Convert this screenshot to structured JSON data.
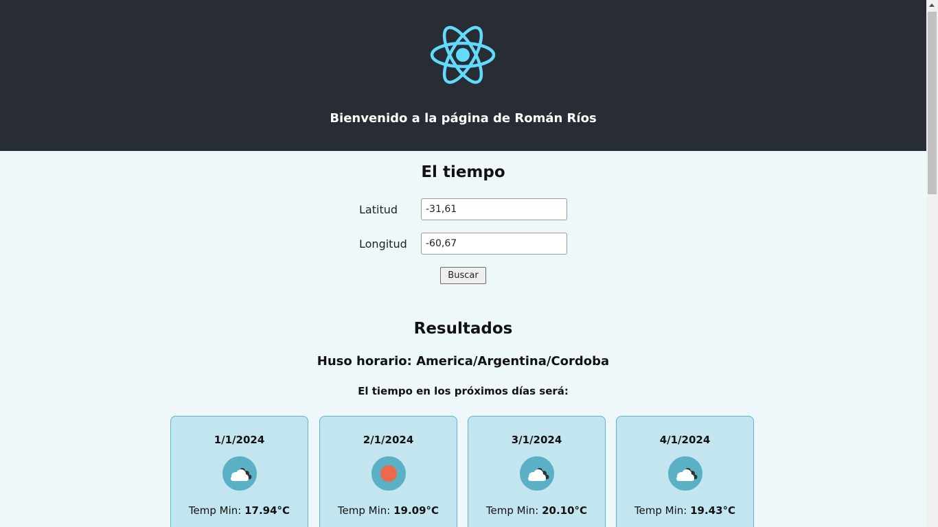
{
  "header": {
    "logo_icon": "react-atom-logo-icon",
    "title": "Bienvenido a la página de Román Ríos"
  },
  "weather": {
    "title": "El tiempo",
    "latitude_label": "Latitud",
    "latitude_value": "-31,61",
    "longitude_label": "Longitud",
    "longitude_value": "-60,67",
    "search_label": "Buscar"
  },
  "results": {
    "title": "Resultados",
    "timezone": "Huso horario: America/Argentina/Cordoba",
    "subtitle": "El tiempo en los próximos días será:",
    "temp_min_label": "Temp Min:",
    "days": [
      {
        "date": "1/1/2024",
        "icon": "cloudy-icon",
        "temp_min": "17.94°C"
      },
      {
        "date": "2/1/2024",
        "icon": "sun-icon",
        "temp_min": "19.09°C"
      },
      {
        "date": "3/1/2024",
        "icon": "cloudy-icon",
        "temp_min": "20.10°C"
      },
      {
        "date": "4/1/2024",
        "icon": "cloudy-icon",
        "temp_min": "19.43°C"
      }
    ]
  },
  "colors": {
    "header_bg": "#282c34",
    "page_bg": "#eef7f9",
    "react_blue": "#61dafb",
    "card_bg": "#c3e5ef",
    "card_border": "#5ab6d2",
    "icon_circle": "#5ab1c5",
    "sun": "#ec6a4c"
  }
}
